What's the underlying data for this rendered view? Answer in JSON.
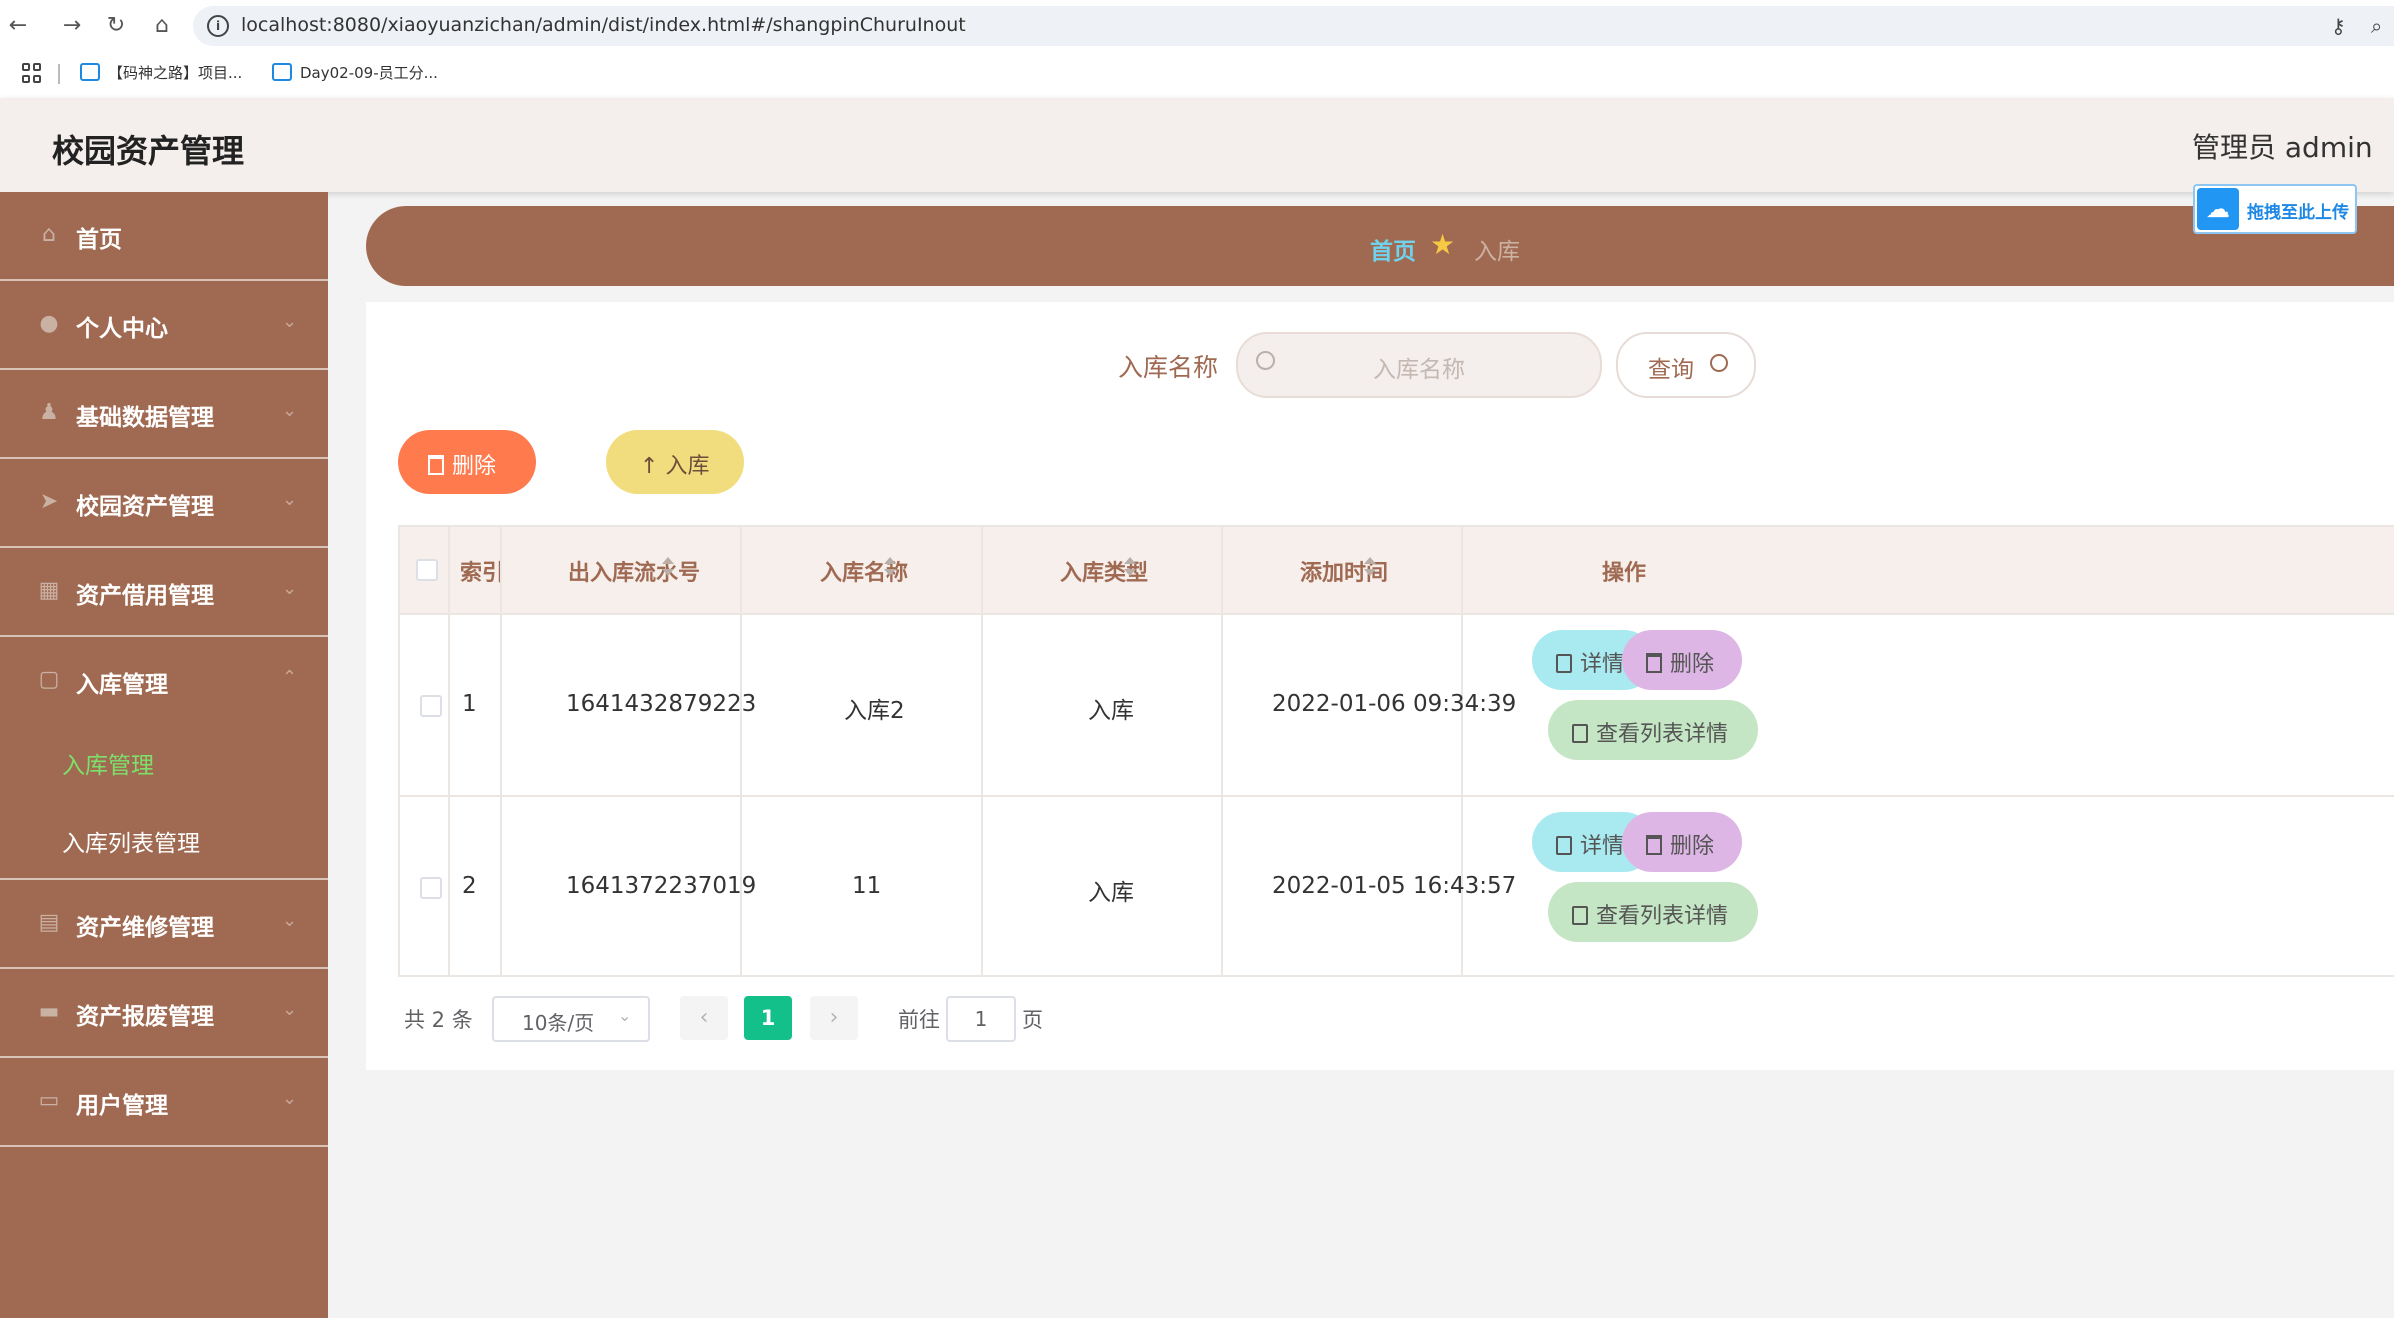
{
  "browser": {
    "url": "localhost:8080/xiaoyuanzichan/admin/dist/index.html#/shangpinChuruInout",
    "bookmarks": [
      "【码神之路】项目...",
      "Day02-09-员工分..."
    ]
  },
  "app": {
    "title": "校园资产管理",
    "admin_label": "管理员 admin",
    "upload_label": "拖拽至此上传"
  },
  "sidebar": {
    "items": [
      {
        "label": "首页",
        "icon": "home-icon"
      },
      {
        "label": "个人中心",
        "icon": "user-icon"
      },
      {
        "label": "基础数据管理",
        "icon": "person-icon"
      },
      {
        "label": "校园资产管理",
        "icon": "send-icon"
      },
      {
        "label": "资产借用管理",
        "icon": "grid-icon"
      },
      {
        "label": "入库管理",
        "icon": "box-icon"
      },
      {
        "label": "资产维修管理",
        "icon": "chart-icon"
      },
      {
        "label": "资产报废管理",
        "icon": "briefcase-icon"
      },
      {
        "label": "用户管理",
        "icon": "ticket-icon"
      }
    ],
    "subitems": [
      {
        "label": "入库管理",
        "active": true
      },
      {
        "label": "入库列表管理",
        "active": false
      }
    ],
    "active_color": "#7ee06a"
  },
  "breadcrumb": {
    "home": "首页",
    "current": "入库"
  },
  "search": {
    "label": "入库名称",
    "placeholder": "入库名称",
    "query_label": "查询"
  },
  "actions": {
    "delete_label": "删除",
    "in_label": "入库"
  },
  "table": {
    "columns": [
      "索引",
      "出入库流水号",
      "入库名称",
      "入库类型",
      "添加时间",
      "操作"
    ],
    "rows": [
      {
        "index": "1",
        "serial": "1641432879223",
        "name": "入库2",
        "type": "入库",
        "time": "2022-01-06 09:34:39"
      },
      {
        "index": "2",
        "serial": "1641372237019",
        "name": "11",
        "type": "入库",
        "time": "2022-01-05 16:43:57"
      }
    ],
    "row_actions": {
      "detail": "详情",
      "delete": "删除",
      "list_detail": "查看列表详情"
    }
  },
  "pagination": {
    "total": "共 2 条",
    "page_size": "10条/页",
    "current_page": "1",
    "goto_label": "前往",
    "goto_value": "1",
    "page_unit": "页"
  },
  "colors": {
    "brand": "#a06a52",
    "header_bg": "#f4eeec",
    "delete_btn": "#ff7a4d",
    "in_btn": "#f1dd7d",
    "page_active": "#13c08a"
  }
}
